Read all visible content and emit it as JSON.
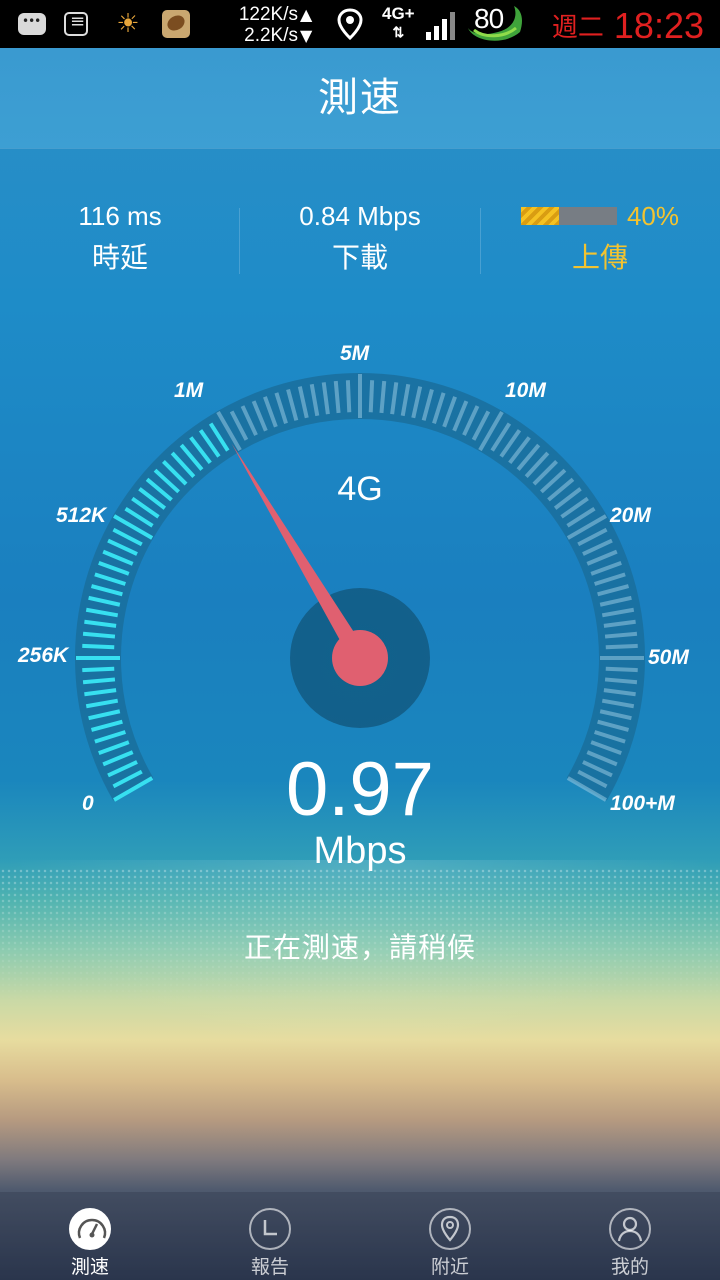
{
  "status_bar": {
    "download_speed": "122K/s",
    "upload_speed": "2.2K/s",
    "network": "4G+",
    "battery": "80",
    "day": "週二",
    "time": "18:23"
  },
  "header": {
    "title": "測速"
  },
  "stats": {
    "latency": {
      "value": "116 ms",
      "label": "時延"
    },
    "download": {
      "value": "0.84 Mbps",
      "label": "下載"
    },
    "upload": {
      "progress_percent": 40,
      "percent_text": "40%",
      "label": "上傳",
      "color": "#f2c330"
    }
  },
  "gauge": {
    "network_type": "4G",
    "scale_labels": [
      "0",
      "256K",
      "512K",
      "1M",
      "5M",
      "10M",
      "20M",
      "50M",
      "100+M"
    ],
    "current_value": "0.97",
    "unit": "Mbps",
    "needle_color": "#e06070",
    "active_tick_color": "#37e0f0"
  },
  "message": "正在測速，請稍候",
  "bottom_nav": [
    {
      "label": "測速",
      "icon": "speedometer-icon",
      "active": true
    },
    {
      "label": "報告",
      "icon": "report-clock-icon",
      "active": false
    },
    {
      "label": "附近",
      "icon": "location-pin-icon",
      "active": false
    },
    {
      "label": "我的",
      "icon": "profile-icon",
      "active": false
    }
  ]
}
